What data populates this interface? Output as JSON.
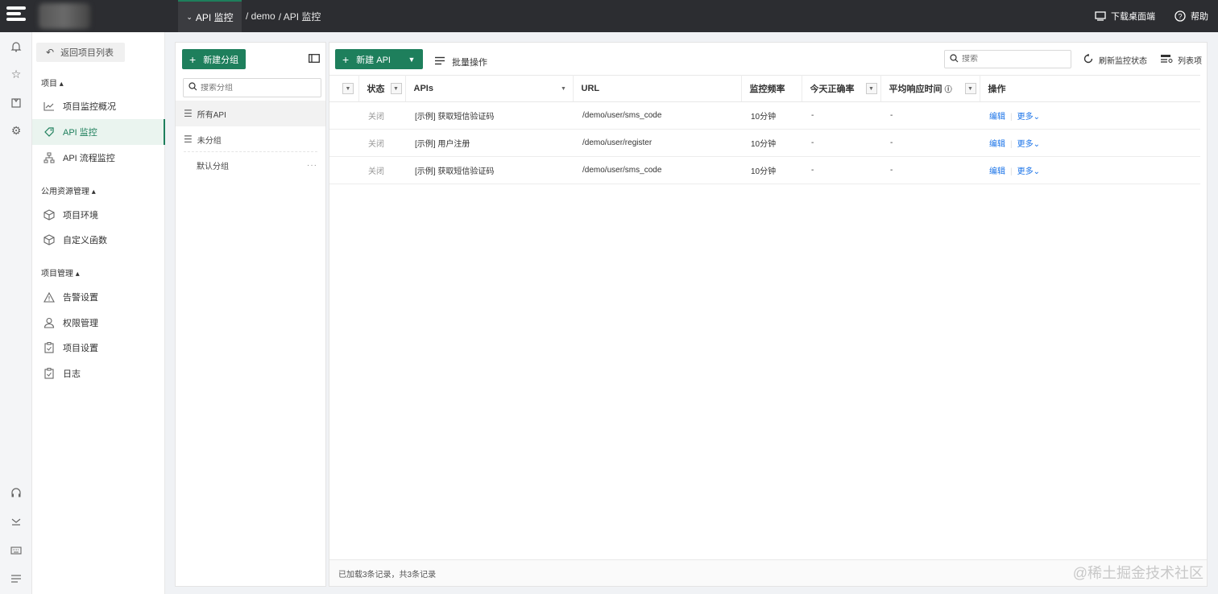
{
  "topbar": {
    "nav_tab": "API 监控",
    "breadcrumb": [
      "/ demo",
      "/ API 监控"
    ],
    "download_label": "下载桌面端",
    "help_label": "帮助"
  },
  "sidebar": {
    "back_label": "返回项目列表",
    "sections": [
      {
        "title": "项目",
        "items": [
          "项目监控概况",
          "API 监控",
          "API 流程监控"
        ]
      },
      {
        "title": "公用资源管理",
        "items": [
          "项目环境",
          "自定义函数"
        ]
      },
      {
        "title": "项目管理",
        "items": [
          "告警设置",
          "权限管理",
          "项目设置",
          "日志"
        ]
      }
    ]
  },
  "groups": {
    "new_group_label": "新建分组",
    "search_placeholder": "搜索分组",
    "items": [
      "所有API",
      "未分组",
      "默认分组"
    ]
  },
  "toolbar": {
    "new_api_label": "新建 API",
    "batch_label": "批量操作",
    "search_placeholder": "搜索",
    "refresh_label": "刷新监控状态",
    "columns_label": "列表项"
  },
  "table": {
    "headers": {
      "status": "状态",
      "apis": "APIs",
      "url": "URL",
      "freq": "监控频率",
      "accuracy": "今天正确率",
      "avg_time": "平均响应时间",
      "ops": "操作"
    },
    "rows": [
      {
        "status": "关闭",
        "api": "[示例] 获取短信验证码",
        "url": "/demo/user/sms_code",
        "freq": "10分钟",
        "accuracy": "-",
        "avg": "-",
        "edit": "编辑",
        "more": "更多"
      },
      {
        "status": "关闭",
        "api": "[示例] 用户注册",
        "url": "/demo/user/register",
        "freq": "10分钟",
        "accuracy": "-",
        "avg": "-",
        "edit": "编辑",
        "more": "更多"
      },
      {
        "status": "关闭",
        "api": "[示例] 获取短信验证码",
        "url": "/demo/user/sms_code",
        "freq": "10分钟",
        "accuracy": "-",
        "avg": "-",
        "edit": "编辑",
        "more": "更多"
      }
    ]
  },
  "footer": {
    "text": "已加载3条记录，共3条记录"
  },
  "watermark": "@稀土掘金技术社区",
  "colors": {
    "accent": "#1e7f5c",
    "topbar": "#2c2d31",
    "link": "#1a73e8"
  }
}
